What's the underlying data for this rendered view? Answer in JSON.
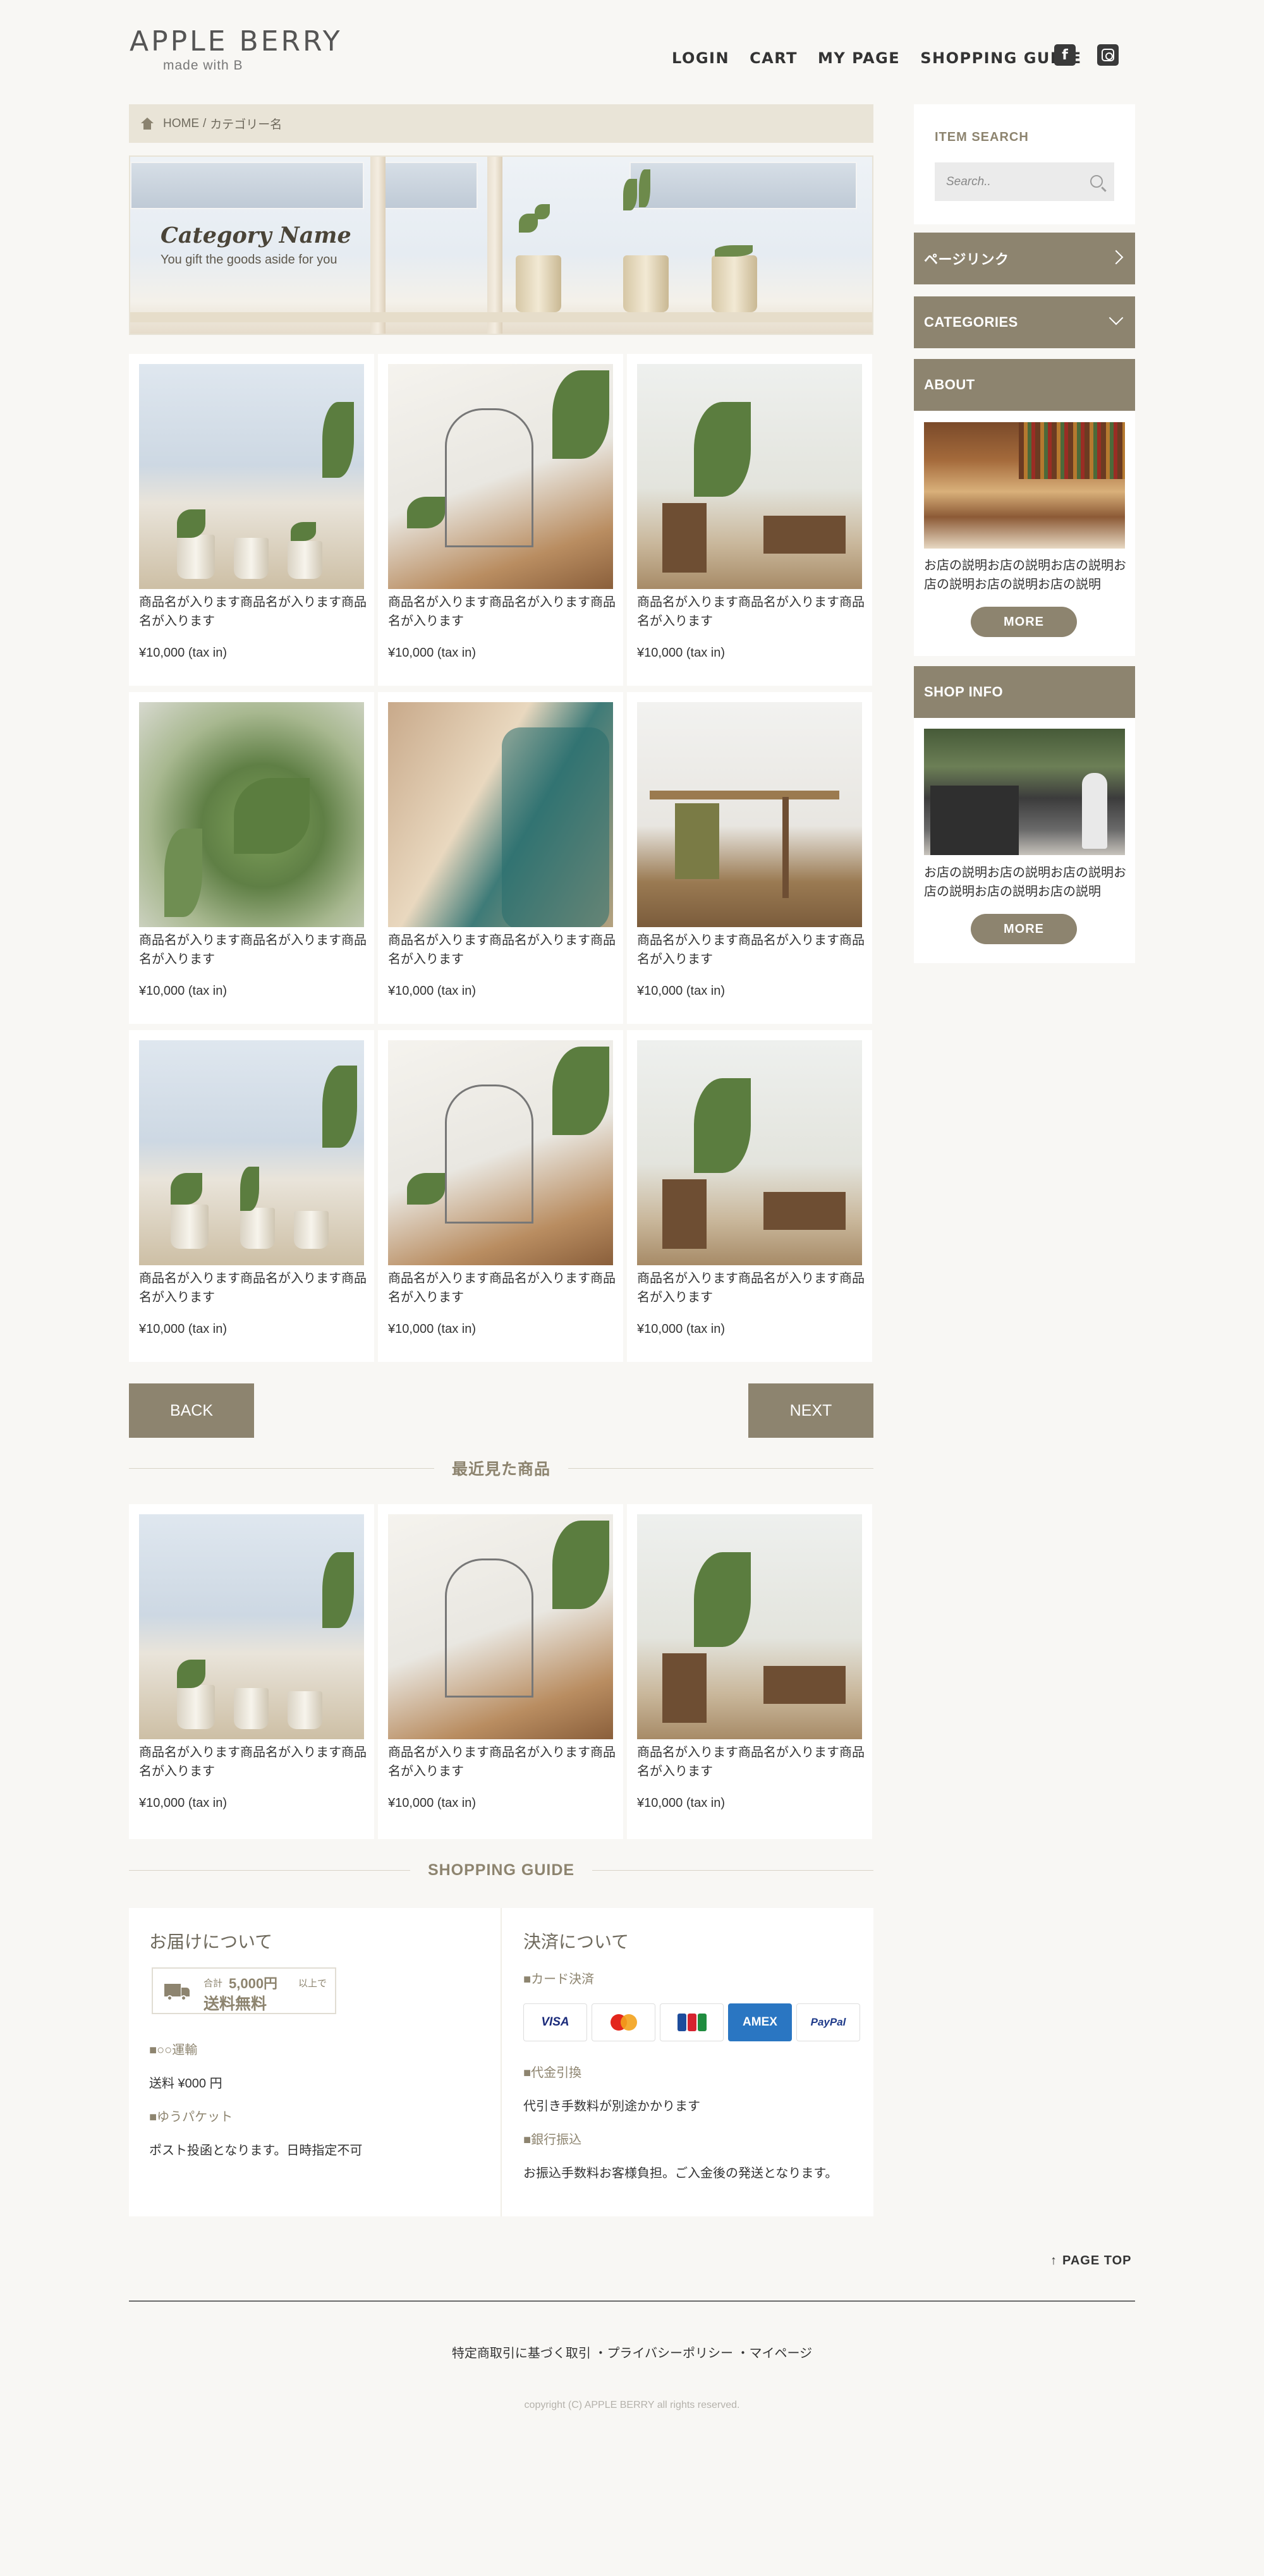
{
  "header": {
    "logo": "APPLE BERRY",
    "tagline": "made with B",
    "nav": [
      "LOGIN",
      "CART",
      "MY PAGE",
      "SHOPPING GUIDE"
    ],
    "facebook_icon": "facebook-icon",
    "instagram_icon": "instagram-icon"
  },
  "breadcrumb": {
    "home": "HOME",
    "sep": "/",
    "current": "カテゴリー名"
  },
  "banner": {
    "title": "Category Name",
    "subtitle": "You gift the goods aside for you"
  },
  "products": [
    {
      "name": "商品名が入ります商品名が入ります商品名が入ります",
      "price": "¥10,000 (tax in)"
    },
    {
      "name": "商品名が入ります商品名が入ります商品名が入ります",
      "price": "¥10,000 (tax in)"
    },
    {
      "name": "商品名が入ります商品名が入ります商品名が入ります",
      "price": "¥10,000 (tax in)"
    },
    {
      "name": "商品名が入ります商品名が入ります商品名が入ります",
      "price": "¥10,000 (tax in)"
    },
    {
      "name": "商品名が入ります商品名が入ります商品名が入ります",
      "price": "¥10,000 (tax in)"
    },
    {
      "name": "商品名が入ります商品名が入ります商品名が入ります",
      "price": "¥10,000 (tax in)"
    },
    {
      "name": "商品名が入ります商品名が入ります商品名が入ります",
      "price": "¥10,000 (tax in)"
    },
    {
      "name": "商品名が入ります商品名が入ります商品名が入ります",
      "price": "¥10,000 (tax in)"
    },
    {
      "name": "商品名が入ります商品名が入ります商品名が入ります",
      "price": "¥10,000 (tax in)"
    }
  ],
  "pager": {
    "back": "BACK",
    "next": "NEXT"
  },
  "recent": {
    "title": "最近見た商品",
    "items": [
      {
        "name": "商品名が入ります商品名が入ります商品名が入ります",
        "price": "¥10,000 (tax in)"
      },
      {
        "name": "商品名が入ります商品名が入ります商品名が入ります",
        "price": "¥10,000 (tax in)"
      },
      {
        "name": "商品名が入ります商品名が入ります商品名が入ります",
        "price": "¥10,000 (tax in)"
      }
    ]
  },
  "sidebar": {
    "search_title": "ITEM SEARCH",
    "search_placeholder": "Search..",
    "page_link": "ページリンク",
    "categories": "CATEGORIES",
    "about_title": "ABOUT",
    "about_text": "お店の説明お店の説明お店の説明お店の説明お店の説明お店の説明",
    "more": "MORE",
    "shop_title": "SHOP INFO",
    "shop_text": "お店の説明お店の説明お店の説明お店の説明お店の説明お店の説明"
  },
  "guide": {
    "title": "SHOPPING GUIDE",
    "delivery_title": "お届けについて",
    "badge_small": "合計",
    "badge_amount": "5,000円",
    "badge_suffix": "以上で",
    "badge_main": "送料無料",
    "carrier_label": "■○○運輸",
    "carrier_text": "送料 ¥000 円",
    "packet_label": "■ゆうパケット",
    "packet_text": "ポスト投函となります。日時指定不可",
    "payment_title": "決済について",
    "card_label": "■カード決済",
    "cards": [
      "VISA",
      "mastercard",
      "JCB",
      "AMEX",
      "PayPal"
    ],
    "cod_label": "■代金引換",
    "cod_text": "代引き手数料が別途かかります",
    "bank_label": "■銀行振込",
    "bank_text": "お振込手数料お客様負担。ご入金後の発送となります。"
  },
  "footer": {
    "page_top": "PAGE TOP",
    "links": "特定商取引に基づく取引 ・プライバシーポリシー ・マイページ",
    "copyright": "copyright (C) APPLE BERRY all rights reserved."
  },
  "colors": {
    "accent": "#8d846f",
    "background": "#f8f7f4",
    "breadcrumb": "#e9e4d7"
  }
}
